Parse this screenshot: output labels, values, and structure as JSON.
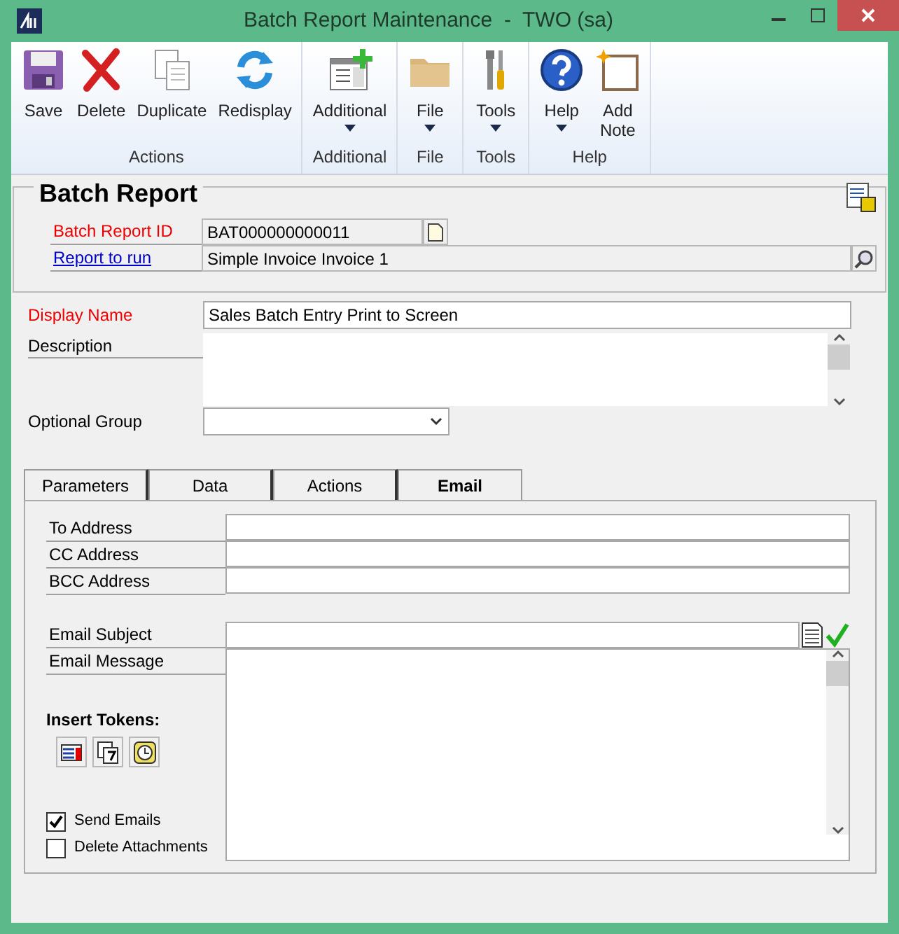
{
  "window": {
    "title": "Batch Report Maintenance  -  TWO (sa)"
  },
  "ribbon": {
    "groups": [
      {
        "label": "Actions",
        "buttons": [
          {
            "label": "Save",
            "kind": "save",
            "dropdown": false
          },
          {
            "label": "Delete",
            "kind": "delete",
            "dropdown": false
          },
          {
            "label": "Duplicate",
            "kind": "duplicate",
            "dropdown": false
          },
          {
            "label": "Redisplay",
            "kind": "redisplay",
            "dropdown": false
          }
        ]
      },
      {
        "label": "Additional",
        "buttons": [
          {
            "label": "Additional",
            "kind": "additional",
            "dropdown": true
          }
        ]
      },
      {
        "label": "File",
        "buttons": [
          {
            "label": "File",
            "kind": "folder",
            "dropdown": true
          }
        ]
      },
      {
        "label": "Tools",
        "buttons": [
          {
            "label": "Tools",
            "kind": "tools",
            "dropdown": true
          }
        ]
      },
      {
        "label": "Help",
        "buttons": [
          {
            "label": "Help",
            "kind": "help",
            "dropdown": true
          },
          {
            "label": "Add Note",
            "kind": "note",
            "dropdown": false
          }
        ]
      }
    ]
  },
  "header": {
    "title": "Batch Report",
    "fields": [
      {
        "label": "Batch Report ID",
        "kind": "required",
        "value": "BAT000000000011"
      },
      {
        "label": "Report to run",
        "kind": "link",
        "value": "Simple Invoice Invoice 1"
      }
    ]
  },
  "display_name": {
    "label": "Display Name",
    "value": "Sales Batch Entry Print to Screen"
  },
  "description": {
    "label": "Description"
  },
  "optional_group": {
    "label": "Optional Group"
  },
  "tabs": [
    {
      "label": "Parameters",
      "selected": false
    },
    {
      "label": "Data",
      "selected": false
    },
    {
      "label": "Actions",
      "selected": false
    },
    {
      "label": "Email",
      "selected": true
    }
  ],
  "email": {
    "address_fields": [
      {
        "label": "To Address"
      },
      {
        "label": "CC Address"
      },
      {
        "label": "BCC Address"
      }
    ],
    "subject_label": "Email Subject",
    "message_label": "Email Message",
    "insert_tokens_label": "Insert Tokens:",
    "checkboxes": [
      {
        "label": "Send Emails",
        "checked": true
      },
      {
        "label": "Delete Attachments",
        "checked": false
      }
    ]
  }
}
